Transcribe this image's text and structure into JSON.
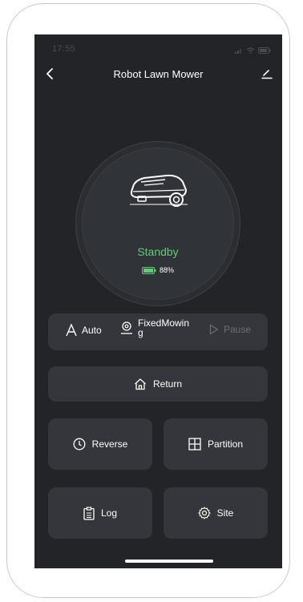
{
  "status_bar": {
    "time": "17:55",
    "icons": [
      "signal-icon",
      "wifi-icon",
      "battery-icon"
    ]
  },
  "nav": {
    "title": "Robot Lawn Mower",
    "back_icon": "chevron-left-icon",
    "edit_icon": "edit-icon"
  },
  "device": {
    "status": "Standby",
    "battery_percent": "88%",
    "battery_level": 0.88,
    "status_color": "#65c97a"
  },
  "modes": {
    "auto_label": "Auto",
    "fixed_label": "FixedMowing",
    "pause_label": "Pause"
  },
  "actions": {
    "return_label": "Return",
    "reverse_label": "Reverse",
    "partition_label": "Partition",
    "log_label": "Log",
    "site_label": "Site"
  },
  "colors": {
    "background": "#232427",
    "card": "#34363b",
    "accent_green": "#65c97a",
    "disabled": "#6b6e74"
  }
}
